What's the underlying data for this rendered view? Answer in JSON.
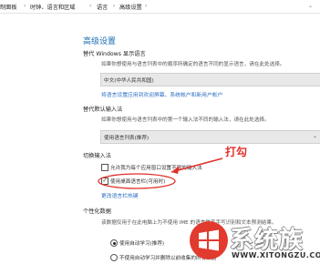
{
  "breadcrumb": {
    "items": [
      "制面板",
      "时钟、语言和区域",
      "语言",
      "高级设置"
    ],
    "separator": "›"
  },
  "page_title": "高级设置",
  "display_language": {
    "title": "替代 Windows 显示语言",
    "desc": "如果你想使用与语言列表中的顺序所确定的语言不同的显示语言，请在此处选择。",
    "dropdown_value": "中文(中华人民共和国)",
    "link": "将语言设置应用到欢迎屏幕、系统帐户和新用户帐户"
  },
  "input_method": {
    "title": "替代默认输入法",
    "desc": "如果你想使用与语言列表中的第一个输入法不同的输入法，请在此处选择。",
    "dropdown_value": "使用语言列表(推荐)"
  },
  "switch_input": {
    "title": "切换输入法",
    "checkbox1_label": "允许我为每个应用窗口设置不同的输入法",
    "checkbox1_checked": false,
    "checkbox2_label": "使用桌面语言栏(可用时)",
    "checkbox2_checked": true,
    "hotkey_link": "更改语言栏热键"
  },
  "personalization": {
    "title": "个性化数据",
    "desc": "该数据仅用于在此电脑上为不使用 IME 的语言提高手写识别和文本预测结果。",
    "radio1_label": "使用自动学习(推荐)",
    "radio1_selected": true,
    "radio2_label": "不使用自动学习并删除以前收集的所有数据"
  },
  "annotation": {
    "text": "打勾",
    "color": "#e0302a"
  },
  "watermark": {
    "brand": "系统族",
    "url": "WWW.XITONGZU.COM",
    "logo_colors": [
      "#e23a2e",
      "#ffffff"
    ]
  },
  "icons": {
    "dropdown": "chevron-down-icon",
    "checkmark": "checkmark-icon",
    "arrow": "red-arrow"
  }
}
